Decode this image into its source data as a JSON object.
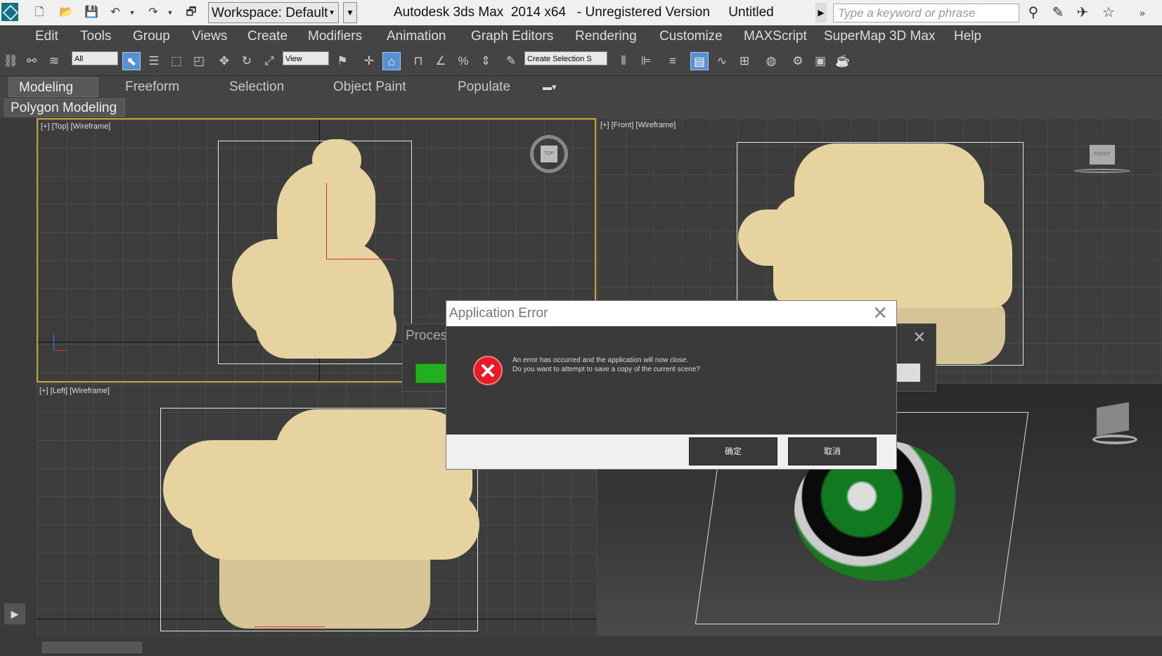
{
  "titlebar": {
    "workspace": "Workspace: Default",
    "app_title": "Autodesk 3ds Max  2014 x64   - Unregistered Version     Untitled",
    "search_placeholder": "Type a keyword or phrase"
  },
  "menu": [
    "Edit",
    "Tools",
    "Group",
    "Views",
    "Create",
    "Modifiers",
    "Animation",
    "Graph Editors",
    "Rendering",
    "Customize",
    "MAXScript",
    "SuperMap 3D Max",
    "Help"
  ],
  "toolbar": {
    "filter_value": "All",
    "coord_value": "View",
    "selection_set_placeholder": "Create Selection S"
  },
  "ribbon": {
    "tabs": [
      "Modeling",
      "Freeform",
      "Selection",
      "Object Paint",
      "Populate"
    ],
    "panel": "Polygon Modeling"
  },
  "viewports": {
    "top": "[+] [Top] [Wireframe]",
    "front": "[+] [Front] [Wireframe]",
    "left": "[+] [Left] [Wireframe]",
    "top_cube": "TOP",
    "front_cube": "FRONT"
  },
  "process_dialog": {
    "title": "Proces"
  },
  "error_dialog": {
    "title": "Application Error",
    "line1": "An error has occurred and the application will now close.",
    "line2": "Do you want to attempt to save a copy of the current scene?",
    "ok": "确定",
    "cancel": "取消"
  },
  "colors": {
    "bg": "#444444",
    "viewport": "#3d3d3d",
    "model": "#e6d3a0",
    "error_red": "#e81c24",
    "progress_green": "#20b020",
    "active_viewport_border": "#c8a23a"
  }
}
